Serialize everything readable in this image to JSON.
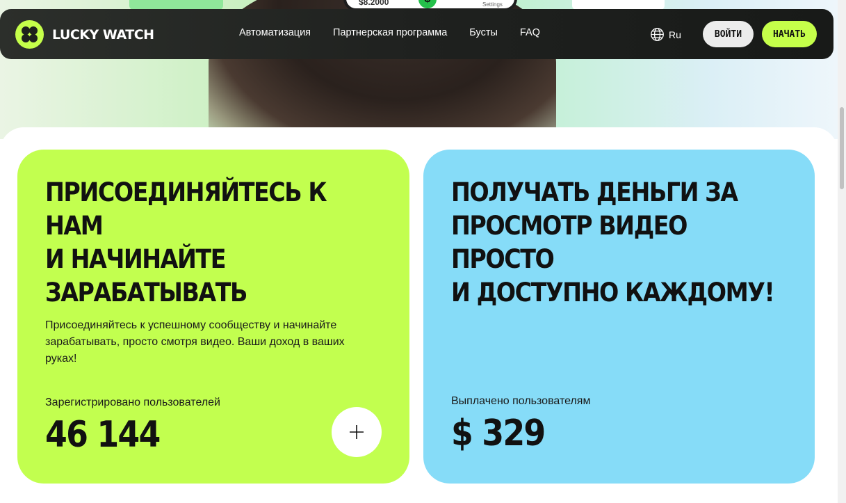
{
  "hero": {
    "phone_balance": "$8.2000",
    "phone_coin": "$",
    "phone_settings": "Settings"
  },
  "navbar": {
    "logo_text": "LUCKY WATCH",
    "links": [
      "Автоматизация",
      "Партнерская программа",
      "Бусты",
      "FAQ"
    ],
    "language": "Ru",
    "login_label": "ВОЙТИ",
    "start_label": "НАЧАТЬ"
  },
  "cards": [
    {
      "title_lines": [
        "ПРИСОЕДИНЯЙТЕСЬ К",
        "НАМ",
        "И НАЧИНАЙТЕ",
        "ЗАРАБАТЫВАТЬ"
      ],
      "description": "Присоединяйтесь к успешному сообществу и начинайте зарабатывать, просто смотря видео. Ваши доход в ваших руках!",
      "stat_label": "Зарегистрировано пользователей",
      "stat_value": "46 144"
    },
    {
      "title_lines": [
        "ПОЛУЧАТЬ ДЕНЬГИ ЗА",
        "ПРОСМОТР ВИДЕО ПРОСТО",
        "И ДОСТУПНО КАЖДОМУ!"
      ],
      "stat_label": "Выплачено пользователям",
      "stat_value": "$ 329"
    }
  ],
  "colors": {
    "accent_green": "#c2ff4f",
    "accent_blue": "#86dcf8",
    "navbar_dark": "#1f211f"
  },
  "icons": {
    "logo": "clover-icon",
    "language": "globe-icon",
    "expand": "plus-icon"
  }
}
